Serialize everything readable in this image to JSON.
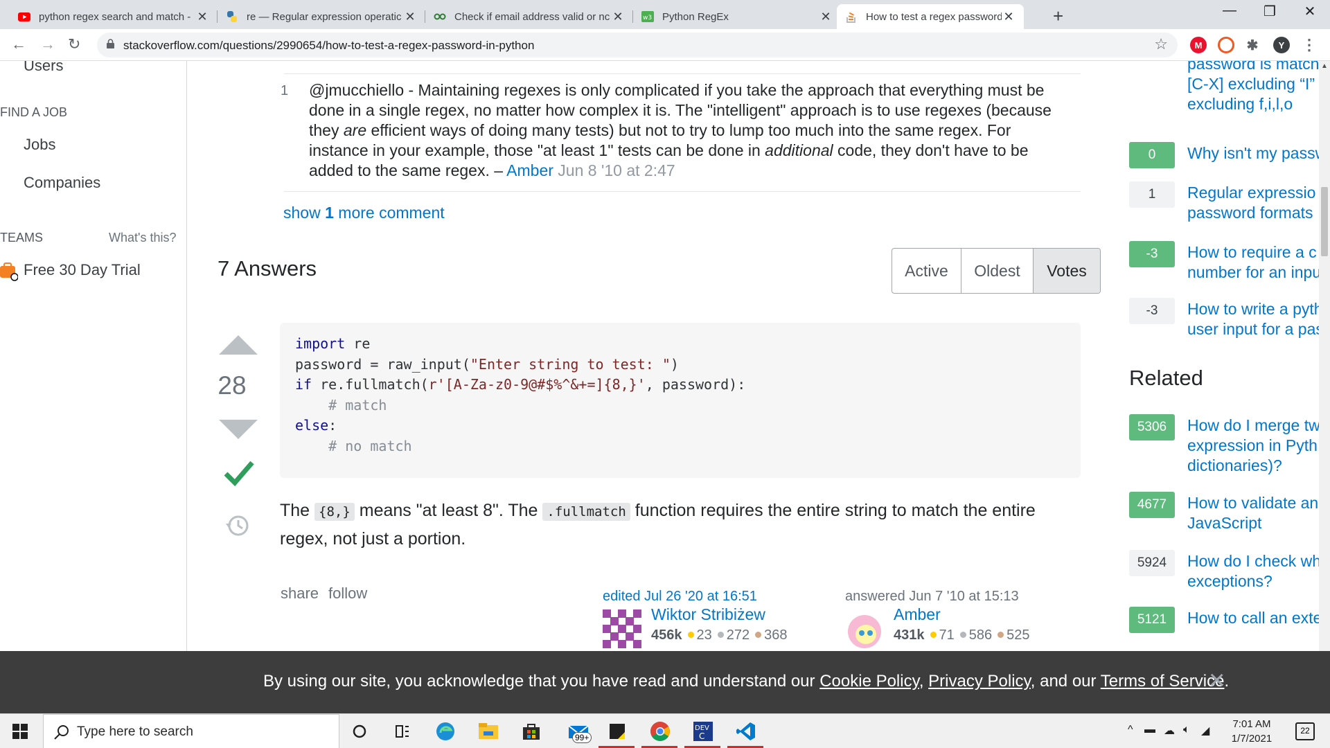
{
  "browser": {
    "tabs": [
      {
        "title": "python regex search and match -",
        "icon": "youtube-icon"
      },
      {
        "title": "re — Regular expression operatic",
        "icon": "python-icon"
      },
      {
        "title": "Check if email address valid or nc",
        "icon": "regex-icon"
      },
      {
        "title": "Python RegEx",
        "icon": "w3schools-icon"
      },
      {
        "title": "How to test a regex password in",
        "icon": "stackoverflow-icon"
      }
    ],
    "url": "stackoverflow.com/questions/2990654/how-to-test-a-regex-password-in-python",
    "profile_initial": "Y"
  },
  "left_nav": {
    "users": "Users",
    "find_a_job": "FIND A JOB",
    "jobs": "Jobs",
    "companies": "Companies",
    "teams": "TEAMS",
    "whats_this": "What's this?",
    "free_trial": "Free 30 Day Trial"
  },
  "comment": {
    "score": "1",
    "text_1": "@jmucchiello - Maintaining regexes is only complicated if you take the approach that everything must be done in a single regex, no matter how complex it is. The \"intelligent\" approach is to use regexes (because they ",
    "em_1": "are",
    "text_2": " efficient ways of doing many tests) but not to try to lump too much into the same regex. For instance in your example, those \"at least 1\" tests can be done in ",
    "em_2": "additional",
    "text_3": " code, they don't have to be added to the same regex. – ",
    "author": "Amber",
    "date": "Jun 8 '10 at 2:47"
  },
  "show_more": {
    "prefix": "show ",
    "count": "1",
    "suffix": " more comment"
  },
  "answers": {
    "heading": "7 Answers",
    "sort": [
      "Active",
      "Oldest",
      "Votes"
    ]
  },
  "answer": {
    "votes": "28",
    "code": {
      "l1_kw": "import",
      "l1_rest": " re",
      "l2": "password = raw_input(",
      "l2_str": "\"Enter string to test: \"",
      "l2_end": ")",
      "l3_kw": "if",
      "l3_mid": " re.fullmatch(",
      "l3_str": "r'[A-Za-z0-9@#$%^&+=]{8,}'",
      "l3_end": ", password):",
      "l4": "# match",
      "l5_kw": "else",
      "l5_end": ":",
      "l6": "# no match"
    },
    "text": {
      "t1": "The ",
      "c1": "{8,}",
      "t2": " means \"at least 8\". The ",
      "c2": ".fullmatch",
      "t3": " function requires the entire string to match the entire regex, not just a portion."
    },
    "menu": {
      "share": "share",
      "follow": "follow"
    },
    "edited": {
      "action": "edited Jul 26 '20 at 16:51",
      "user": "Wiktor Stribiżew",
      "rep": "456k",
      "gold": "23",
      "silver": "272",
      "bronze": "368"
    },
    "answered": {
      "action": "answered Jun 7 '10 at 15:13",
      "user": "Amber",
      "rep": "431k",
      "gold": "71",
      "silver": "586",
      "bronze": "525"
    }
  },
  "sidebar": {
    "top_partial": {
      "line1": "password is match",
      "line2": "[C-X] excluding “I”",
      "line3": "excluding f,i,l,o"
    },
    "linked": [
      {
        "score": "0",
        "answered": true,
        "title_lines": [
          "Why isn't my passw"
        ]
      },
      {
        "score": "1",
        "answered": false,
        "title_lines": [
          "Regular expressio",
          "password formats"
        ]
      },
      {
        "score": "-3",
        "answered": true,
        "title_lines": [
          "How to require a c",
          "number for an inpu"
        ]
      },
      {
        "score": "-3",
        "answered": false,
        "title_lines": [
          "How to write a pyth",
          "user input for a pas"
        ]
      }
    ],
    "related_heading": "Related",
    "related": [
      {
        "score": "5306",
        "answered": true,
        "title_lines": [
          "How do I merge tw",
          "expression in Pyth",
          "dictionaries)?"
        ]
      },
      {
        "score": "4677",
        "answered": true,
        "title_lines": [
          "How to validate an",
          "JavaScript"
        ]
      },
      {
        "score": "5924",
        "answered": false,
        "title_lines": [
          "How do I check wh",
          "exceptions?"
        ]
      },
      {
        "score": "5121",
        "answered": true,
        "title_lines": [
          "How to call an exte"
        ]
      }
    ]
  },
  "cookie_banner": {
    "text_1": "By using our site, you acknowledge that you have read and understand our ",
    "cookie_policy": "Cookie Policy",
    "sep_1": ", ",
    "privacy_policy": "Privacy Policy",
    "sep_2": ", and our ",
    "terms": "Terms of Service",
    "end": ".",
    "close": "×"
  },
  "taskbar": {
    "search_placeholder": "Type here to search",
    "mail_badge": "99+",
    "time": "7:01 AM",
    "date": "1/7/2021",
    "notifications": "22"
  },
  "colors": {
    "accent_link": "#0077cc",
    "accepted_green": "#2f9e5d",
    "answered_score_bg": "#5eba7d",
    "cookie_bg": "#3d3d3d"
  }
}
